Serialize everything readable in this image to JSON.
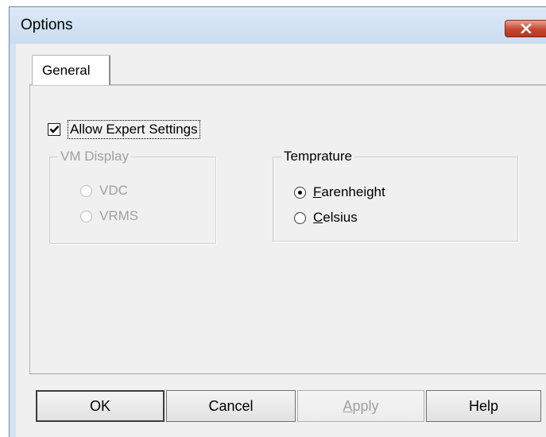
{
  "window": {
    "title": "Options",
    "close_icon": "close-x-icon"
  },
  "tabs": [
    {
      "label": "General",
      "selected": true
    }
  ],
  "general": {
    "allow_expert": {
      "label": "Allow Expert Settings",
      "checked": true
    },
    "vm_display": {
      "legend": "VM Display",
      "enabled": false,
      "options": [
        {
          "label": "VDC",
          "selected": false
        },
        {
          "label": "VRMS",
          "selected": false
        }
      ]
    },
    "temperature": {
      "legend": "Temprature",
      "enabled": true,
      "options": [
        {
          "label": "Farenheight",
          "mnemonic": "F",
          "selected": true
        },
        {
          "label": "Celsius",
          "mnemonic": "C",
          "selected": false
        }
      ]
    }
  },
  "buttons": {
    "ok": {
      "label": "OK",
      "enabled": true
    },
    "cancel": {
      "label": "Cancel",
      "enabled": true
    },
    "apply": {
      "label": "Apply",
      "enabled": false
    },
    "help": {
      "label": "Help",
      "enabled": true
    }
  },
  "colors": {
    "titlebar": "#d3e3f3",
    "close_button": "#c6462f",
    "face": "#f0f0f0",
    "disabled_text": "#a0a0a0"
  }
}
